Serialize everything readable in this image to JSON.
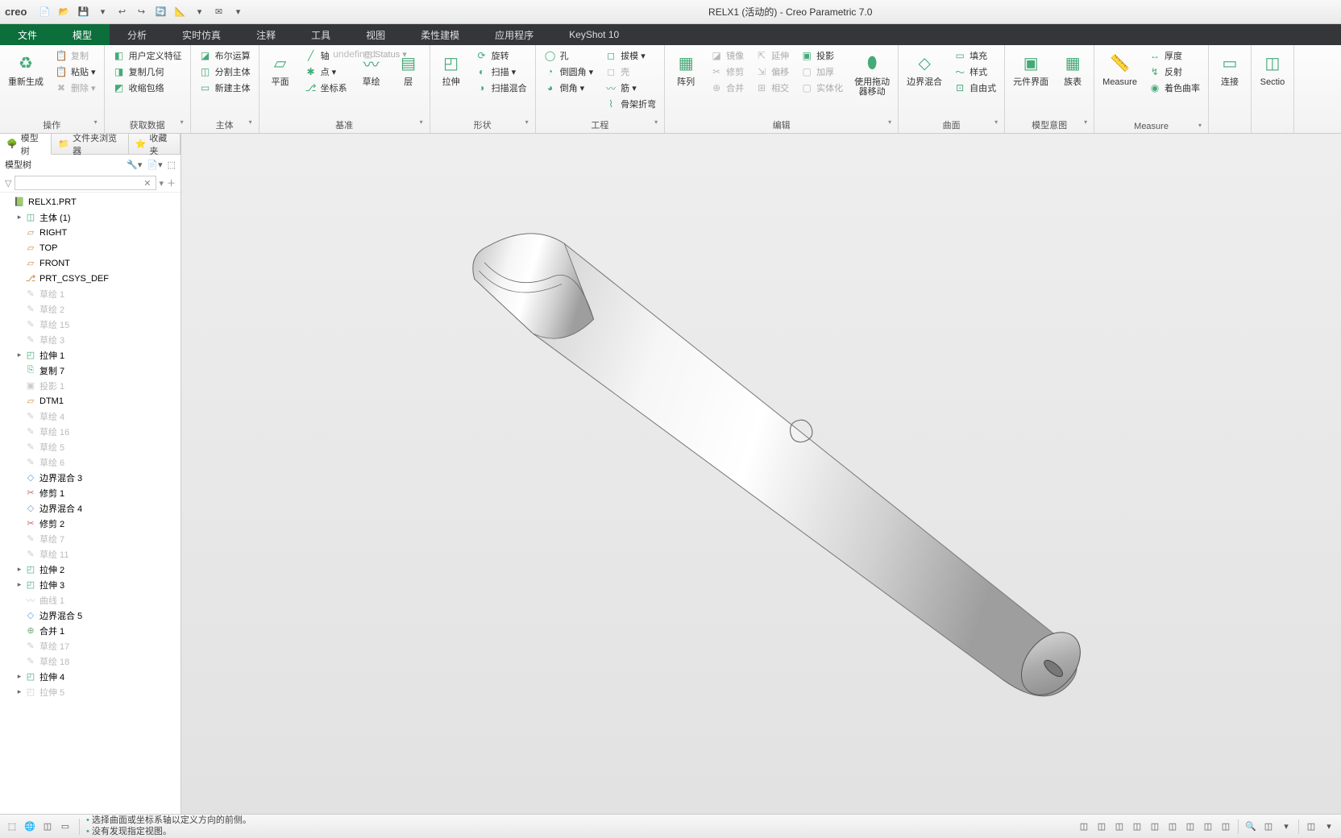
{
  "app": {
    "logo": "creo",
    "title": "RELX1 (活动的) - Creo Parametric 7.0"
  },
  "qat": [
    "📄",
    "📂",
    "💾",
    "▾",
    "↩",
    "↪",
    "🔄",
    "📐",
    "▾",
    "✉",
    "▾"
  ],
  "menus": {
    "file": "文件",
    "tabs": [
      "模型",
      "分析",
      "实时仿真",
      "注释",
      "工具",
      "视图",
      "柔性建模",
      "应用程序",
      "KeyShot 10"
    ]
  },
  "ribbon": {
    "groups": [
      {
        "label": "操作",
        "big": [
          {
            "ic": "♻",
            "lb": "重新生成"
          }
        ],
        "col": [
          {
            "ic": "📋",
            "lb": "复制",
            "dis": true
          },
          {
            "ic": "📋",
            "lb": "粘贴 ▾"
          },
          {
            "ic": "✖",
            "lb": "删除 ▾",
            "dis": true
          }
        ]
      },
      {
        "label": "获取数据",
        "col": [
          {
            "ic": "◧",
            "lb": "用户定义特征"
          },
          {
            "ic": "◨",
            "lb": "复制几何"
          },
          {
            "ic": "◩",
            "lb": "收缩包络"
          }
        ]
      },
      {
        "label": "主体",
        "col": [
          {
            "ic": "◪",
            "lb": "布尔运算"
          },
          {
            "ic": "◫",
            "lb": "分割主体"
          },
          {
            "ic": "▭",
            "lb": "新建主体"
          }
        ]
      },
      {
        "label": "基准",
        "big": [
          {
            "ic": "▱",
            "lb": "平面"
          }
        ],
        "col": [
          {
            "ic": "╱",
            "lb": "轴"
          },
          {
            "ic": "✱",
            "lb": "点 ▾"
          },
          {
            "ic": "⎇",
            "lb": "坐标系"
          }
        ],
        "big2": [
          {
            "ic": "〰",
            "lb": "草绘"
          },
          {
            "ic": "▤",
            "lb": "层"
          }
        ],
        "extra": {
          "lb": "◫ Status ▾",
          "dis": true
        }
      },
      {
        "label": "形状",
        "big": [
          {
            "ic": "◰",
            "lb": "拉伸"
          }
        ],
        "col": [
          {
            "ic": "⟳",
            "lb": "旋转"
          },
          {
            "ic": "◐",
            "lb": "扫描 ▾"
          },
          {
            "ic": "◑",
            "lb": "扫描混合"
          }
        ]
      },
      {
        "label": "工程",
        "col1": [
          {
            "ic": "◯",
            "lb": "孔"
          },
          {
            "ic": "◔",
            "lb": "倒圆角 ▾"
          },
          {
            "ic": "◕",
            "lb": "倒角 ▾"
          }
        ],
        "col2": [
          {
            "ic": "◻",
            "lb": "拔模 ▾"
          },
          {
            "ic": "◻",
            "lb": "壳",
            "dis": true
          },
          {
            "ic": "〰",
            "lb": "筋 ▾"
          },
          {
            "ic": "⌇",
            "lb": "骨架折弯"
          }
        ]
      },
      {
        "label": "编辑",
        "big": [
          {
            "ic": "▦",
            "lb": "阵列"
          }
        ],
        "col1": [
          {
            "ic": "◪",
            "lb": "镜像",
            "dis": true
          },
          {
            "ic": "✂",
            "lb": "修剪",
            "dis": true
          },
          {
            "ic": "⊕",
            "lb": "合并",
            "dis": true
          }
        ],
        "col2": [
          {
            "ic": "⇱",
            "lb": "延伸",
            "dis": true
          },
          {
            "ic": "⇲",
            "lb": "偏移",
            "dis": true
          },
          {
            "ic": "⊞",
            "lb": "相交",
            "dis": true
          }
        ],
        "col3": [
          {
            "ic": "▣",
            "lb": "投影"
          },
          {
            "ic": "▢",
            "lb": "加厚",
            "dis": true
          },
          {
            "ic": "▢",
            "lb": "实体化",
            "dis": true
          }
        ],
        "big2": [
          {
            "ic": "⬮",
            "lb": "使用拖动\n器移动"
          }
        ]
      },
      {
        "label": "曲面",
        "big": [
          {
            "ic": "◇",
            "lb": "边界混合"
          }
        ],
        "col": [
          {
            "ic": "▭",
            "lb": "填充"
          },
          {
            "ic": "〜",
            "lb": "样式"
          },
          {
            "ic": "⊡",
            "lb": "自由式"
          }
        ]
      },
      {
        "label": "模型意图",
        "big": [
          {
            "ic": "▣",
            "lb": "元件界面"
          },
          {
            "ic": "▦",
            "lb": "族表"
          }
        ]
      },
      {
        "label": "Measure",
        "big": [
          {
            "ic": "📏",
            "lb": "Measure"
          }
        ],
        "col": [
          {
            "ic": "↔",
            "lb": "厚度"
          },
          {
            "ic": "↯",
            "lb": "反射"
          },
          {
            "ic": "◉",
            "lb": "着色曲率"
          }
        ]
      },
      {
        "label": "",
        "big": [
          {
            "ic": "▭",
            "lb": "连接"
          }
        ]
      },
      {
        "label": "",
        "big": [
          {
            "ic": "◫",
            "lb": "Sectio"
          }
        ]
      }
    ]
  },
  "sidetabs": [
    {
      "ic": "🌳",
      "lb": "模型树",
      "active": true
    },
    {
      "ic": "📁",
      "lb": "文件夹浏览器"
    },
    {
      "ic": "⭐",
      "lb": "收藏夹"
    }
  ],
  "treehdr": {
    "title": "模型树",
    "tools": [
      "🔧▾",
      "📄▾",
      "⬚"
    ]
  },
  "tree": [
    {
      "d": 0,
      "exp": "",
      "ic": "📗",
      "cls": "ic-prt",
      "lb": "RELX1.PRT"
    },
    {
      "d": 1,
      "exp": "▸",
      "ic": "◫",
      "cls": "ic-body",
      "lb": "主体 (1)"
    },
    {
      "d": 1,
      "exp": "",
      "ic": "▱",
      "cls": "ic-dtm",
      "lb": "RIGHT"
    },
    {
      "d": 1,
      "exp": "",
      "ic": "▱",
      "cls": "ic-dtm",
      "lb": "TOP"
    },
    {
      "d": 1,
      "exp": "",
      "ic": "▱",
      "cls": "ic-dtm",
      "lb": "FRONT"
    },
    {
      "d": 1,
      "exp": "",
      "ic": "⎇",
      "cls": "ic-csys",
      "lb": "PRT_CSYS_DEF"
    },
    {
      "d": 1,
      "exp": "",
      "ic": "✎",
      "cls": "ic-sketch",
      "lb": "草绘 1",
      "dim": true
    },
    {
      "d": 1,
      "exp": "",
      "ic": "✎",
      "cls": "ic-sketch",
      "lb": "草绘 2",
      "dim": true
    },
    {
      "d": 1,
      "exp": "",
      "ic": "✎",
      "cls": "ic-sketch",
      "lb": "草绘 15",
      "dim": true
    },
    {
      "d": 1,
      "exp": "",
      "ic": "✎",
      "cls": "ic-sketch",
      "lb": "草绘 3",
      "dim": true
    },
    {
      "d": 1,
      "exp": "▸",
      "ic": "◰",
      "cls": "ic-feat",
      "lb": "拉伸 1"
    },
    {
      "d": 1,
      "exp": "",
      "ic": "⎘",
      "cls": "ic-feat",
      "lb": "复制 7"
    },
    {
      "d": 1,
      "exp": "",
      "ic": "▣",
      "cls": "ic-feat",
      "lb": "投影 1",
      "dim": true
    },
    {
      "d": 1,
      "exp": "",
      "ic": "▱",
      "cls": "ic-dtm",
      "lb": "DTM1"
    },
    {
      "d": 1,
      "exp": "",
      "ic": "✎",
      "cls": "ic-sketch",
      "lb": "草绘 4",
      "dim": true
    },
    {
      "d": 1,
      "exp": "",
      "ic": "✎",
      "cls": "ic-sketch",
      "lb": "草绘 16",
      "dim": true
    },
    {
      "d": 1,
      "exp": "",
      "ic": "✎",
      "cls": "ic-sketch",
      "lb": "草绘 5",
      "dim": true
    },
    {
      "d": 1,
      "exp": "",
      "ic": "✎",
      "cls": "ic-sketch",
      "lb": "草绘 6",
      "dim": true
    },
    {
      "d": 1,
      "exp": "",
      "ic": "◇",
      "cls": "ic-bnd",
      "lb": "边界混合 3"
    },
    {
      "d": 1,
      "exp": "",
      "ic": "✂",
      "cls": "ic-trim",
      "lb": "修剪 1"
    },
    {
      "d": 1,
      "exp": "",
      "ic": "◇",
      "cls": "ic-bnd",
      "lb": "边界混合 4"
    },
    {
      "d": 1,
      "exp": "",
      "ic": "✂",
      "cls": "ic-trim",
      "lb": "修剪 2"
    },
    {
      "d": 1,
      "exp": "",
      "ic": "✎",
      "cls": "ic-sketch",
      "lb": "草绘 7",
      "dim": true
    },
    {
      "d": 1,
      "exp": "",
      "ic": "✎",
      "cls": "ic-sketch",
      "lb": "草绘 11",
      "dim": true
    },
    {
      "d": 1,
      "exp": "▸",
      "ic": "◰",
      "cls": "ic-feat",
      "lb": "拉伸 2"
    },
    {
      "d": 1,
      "exp": "▸",
      "ic": "◰",
      "cls": "ic-feat",
      "lb": "拉伸 3"
    },
    {
      "d": 1,
      "exp": "",
      "ic": "〰",
      "cls": "ic-curve",
      "lb": "曲线 1",
      "dim": true
    },
    {
      "d": 1,
      "exp": "",
      "ic": "◇",
      "cls": "ic-bnd",
      "lb": "边界混合 5"
    },
    {
      "d": 1,
      "exp": "",
      "ic": "⊕",
      "cls": "ic-merge",
      "lb": "合并 1"
    },
    {
      "d": 1,
      "exp": "",
      "ic": "✎",
      "cls": "ic-sketch",
      "lb": "草绘 17",
      "dim": true
    },
    {
      "d": 1,
      "exp": "",
      "ic": "✎",
      "cls": "ic-sketch",
      "lb": "草绘 18",
      "dim": true
    },
    {
      "d": 1,
      "exp": "▸",
      "ic": "◰",
      "cls": "ic-feat",
      "lb": "拉伸 4"
    },
    {
      "d": 1,
      "exp": "▸",
      "ic": "◰",
      "cls": "ic-feat",
      "lb": "拉伸 5",
      "dim": true
    }
  ],
  "status": {
    "left": [
      "⬚",
      "🌐",
      "◫",
      "▭"
    ],
    "msgs": [
      "选择曲面或坐标系轴以定义方向的前侧。",
      "没有发现指定视图。"
    ],
    "right": [
      "◫",
      "◫",
      "◫",
      "◫",
      "◫",
      "◫",
      "◫",
      "◫",
      "◫",
      "|",
      "🔍",
      "◫",
      "▾",
      "|",
      "◫",
      "▾"
    ]
  }
}
